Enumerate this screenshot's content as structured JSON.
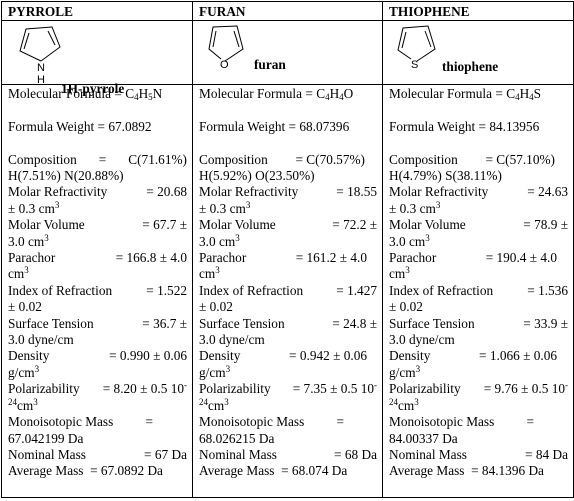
{
  "columns": [
    {
      "header": "PYRROLE",
      "structure_label": "1H-pyrrole",
      "heteroatom": "N",
      "heteroatom_h": "H",
      "formula_label": "Molecular Formula = ",
      "formula_parts": [
        "C",
        "4",
        "H",
        "5",
        "N"
      ],
      "formula_weight": "Formula Weight = 67.0892",
      "composition_label": "Composition",
      "composition_eq": "=",
      "composition_c": "C(71.61%)",
      "composition_rest": "H(7.51%) N(20.88%)",
      "molar_refractivity_label": "Molar Refractivity",
      "molar_refractivity_value": "=  20.68",
      "molar_refractivity_unit": "± 0.3 cm",
      "molar_volume_label": "Molar Volume",
      "molar_volume_value": "= 67.7 ±",
      "molar_volume_unit": "3.0 cm",
      "parachor_label": "Parachor",
      "parachor_value": "=  166.8  ±  4.0",
      "parachor_unit": "cm",
      "refraction_label": "Index of Refraction",
      "refraction_value": "=  1.522",
      "refraction_unit": "± 0.02",
      "surface_tension_label": "Surface Tension",
      "surface_tension_value": "= 36.7 ±",
      "surface_tension_unit": "3.0 dyne/cm",
      "density_label": "Density",
      "density_value": "=  0.990  ±  0.06",
      "density_unit": "g/cm",
      "polarizability_label": "Polarizability",
      "polarizability_value": "= 8.20 ± 0.5 10",
      "polarizability_exp": "24",
      "polarizability_unit": "cm",
      "monoisotopic_label": "Monoisotopic Mass",
      "monoisotopic_eq": "=",
      "monoisotopic_value": "67.042199 Da",
      "nominal_label": "Nominal Mass",
      "nominal_value": "= 67 Da",
      "average_mass": "Average Mass  = 67.0892 Da"
    },
    {
      "header": "FURAN",
      "structure_label": "furan",
      "heteroatom": "O",
      "heteroatom_h": "",
      "formula_label": "Molecular Formula = ",
      "formula_parts": [
        "C",
        "4",
        "H",
        "4",
        "O"
      ],
      "formula_weight": "Formula Weight = 68.07396",
      "composition_label": "Composition",
      "composition_eq": "=",
      "composition_c": "C(70.57%)",
      "composition_rest": "H(5.92%) O(23.50%)",
      "molar_refractivity_label": "Molar Refractivity",
      "molar_refractivity_value": "= 18.55",
      "molar_refractivity_unit": "± 0.3 cm",
      "molar_volume_label": "Molar Volume",
      "molar_volume_value": "= 72.2 ±",
      "molar_volume_unit": "3.0 cm",
      "parachor_label": "Parachor",
      "parachor_value": "= 161.2 ± 4.0",
      "parachor_unit": "cm",
      "refraction_label": "Index of Refraction",
      "refraction_value": "= 1.427",
      "refraction_unit": "± 0.02",
      "surface_tension_label": "Surface Tension",
      "surface_tension_value": "= 24.8 ±",
      "surface_tension_unit": "3.0 dyne/cm",
      "density_label": "Density",
      "density_value": "= 0.942 ± 0.06",
      "density_unit": "g/cm",
      "polarizability_label": "Polarizability",
      "polarizability_value": "= 7.35 ± 0.5 10",
      "polarizability_exp": "24",
      "polarizability_unit": "cm",
      "monoisotopic_label": "Monoisotopic Mass",
      "monoisotopic_eq": "=",
      "monoisotopic_value": "68.026215 Da",
      "nominal_label": "Nominal Mass",
      "nominal_value": "= 68 Da",
      "average_mass": "Average Mass  = 68.074 Da"
    },
    {
      "header": "THIOPHENE",
      "structure_label": "thiophene",
      "heteroatom": "S",
      "heteroatom_h": "",
      "formula_label": "Molecular Formula = ",
      "formula_parts": [
        "C",
        "4",
        "H",
        "4",
        "S"
      ],
      "formula_weight": "Formula Weight = 84.13956",
      "composition_label": "Composition",
      "composition_eq": "=",
      "composition_c": "C(57.10%)",
      "composition_rest": "H(4.79%) S(38.11%)",
      "molar_refractivity_label": "Molar Refractivity",
      "molar_refractivity_value": "= 24.63",
      "molar_refractivity_unit": "± 0.3 cm",
      "molar_volume_label": "Molar Volume",
      "molar_volume_value": "= 78.9 ±",
      "molar_volume_unit": "3.0 cm",
      "parachor_label": "Parachor",
      "parachor_value": "= 190.4 ± 4.0",
      "parachor_unit": "cm",
      "refraction_label": "Index of Refraction",
      "refraction_value": "= 1.536",
      "refraction_unit": "± 0.02",
      "surface_tension_label": "Surface Tension",
      "surface_tension_value": "= 33.9 ±",
      "surface_tension_unit": "3.0 dyne/cm",
      "density_label": "Density",
      "density_value": "= 1.066 ± 0.06",
      "density_unit": "g/cm",
      "polarizability_label": "Polarizability",
      "polarizability_value": "= 9.76 ± 0.5 10",
      "polarizability_exp": "24",
      "polarizability_unit": "cm",
      "monoisotopic_label": "Monoisotopic Mass",
      "monoisotopic_eq": "=",
      "monoisotopic_value": "84.00337 Da",
      "nominal_label": "Nominal Mass",
      "nominal_value": "= 84 Da",
      "average_mass": "Average Mass  = 84.1396 Da"
    }
  ],
  "superscripts": {
    "cubed": "3",
    "minus": "-"
  }
}
